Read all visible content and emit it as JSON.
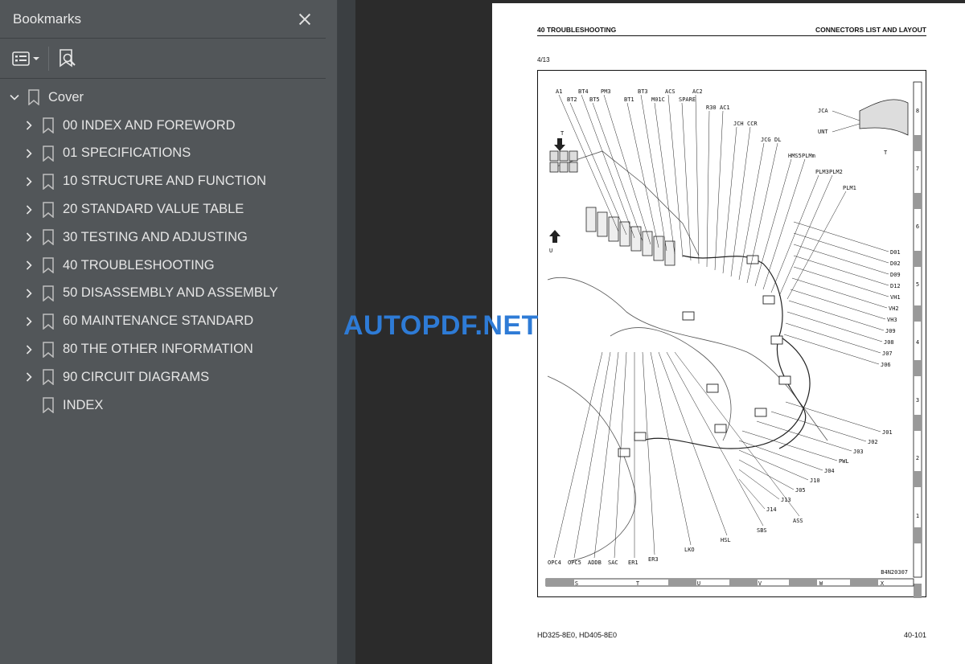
{
  "sidebar": {
    "title": "Bookmarks",
    "close_icon": "close-icon",
    "tools": [
      "bookmark-options-icon",
      "find-bookmark-icon"
    ],
    "items": [
      {
        "label": "Cover",
        "expanded": true,
        "level": 0
      },
      {
        "label": "00 INDEX AND FOREWORD",
        "expanded": false,
        "level": 1
      },
      {
        "label": "01 SPECIFICATIONS",
        "expanded": false,
        "level": 1
      },
      {
        "label": "10 STRUCTURE AND FUNCTION",
        "expanded": false,
        "level": 1
      },
      {
        "label": "20 STANDARD VALUE TABLE",
        "expanded": false,
        "level": 1
      },
      {
        "label": "30 TESTING AND ADJUSTING",
        "expanded": false,
        "level": 1
      },
      {
        "label": "40 TROUBLESHOOTING",
        "expanded": false,
        "level": 1
      },
      {
        "label": "50 DISASSEMBLY AND ASSEMBLY",
        "expanded": false,
        "level": 1
      },
      {
        "label": "60 MAINTENANCE STANDARD",
        "expanded": false,
        "level": 1
      },
      {
        "label": "80 THE OTHER INFORMATION",
        "expanded": false,
        "level": 1
      },
      {
        "label": "90 CIRCUIT DIAGRAMS",
        "expanded": false,
        "level": 1
      },
      {
        "label": "INDEX",
        "expanded": null,
        "level": 1
      }
    ]
  },
  "page": {
    "header_left": "40 TROUBLESHOOTING",
    "header_right": "CONNECTORS LIST AND LAYOUT",
    "page_count": "4/13",
    "footer_left": "HD325-8E0, HD405-8E0",
    "footer_right": "40-101",
    "figure_id": "B4N20307"
  },
  "drawing": {
    "top_labels": [
      "A1",
      "BT2",
      "BT4",
      "BT5",
      "PM3",
      "BT1",
      "BT3",
      "M01C",
      "ACS",
      "SPARE",
      "AC2",
      "R30",
      "AC1",
      "JCH",
      "CCR",
      "JCG",
      "DL",
      "HMS5",
      "PLMm",
      "PLM3",
      "PLM2",
      "PLM1"
    ],
    "right_labels": [
      "D01",
      "D02",
      "D09",
      "D12",
      "VH1",
      "VH2",
      "VH3",
      "J09",
      "J08",
      "J07",
      "J06",
      "J01",
      "J02",
      "J03",
      "PWL",
      "J04",
      "J10",
      "J05",
      "J13",
      "J14"
    ],
    "bottom_labels": [
      "OPC4",
      "OPC5",
      "ADDB",
      "SAC",
      "ER1",
      "ER3",
      "LKO",
      "HSL",
      "SBS",
      "ASS"
    ],
    "inset_labels": [
      "JCA",
      "UNT"
    ],
    "marker_T": "T",
    "marker_U": "U",
    "grid_rows": [
      "8",
      "7",
      "6",
      "5",
      "4",
      "3",
      "2",
      "1"
    ],
    "grid_cols": [
      "S",
      "T",
      "U",
      "V",
      "W",
      "X"
    ]
  },
  "watermark": "AUTOPDF.NET"
}
